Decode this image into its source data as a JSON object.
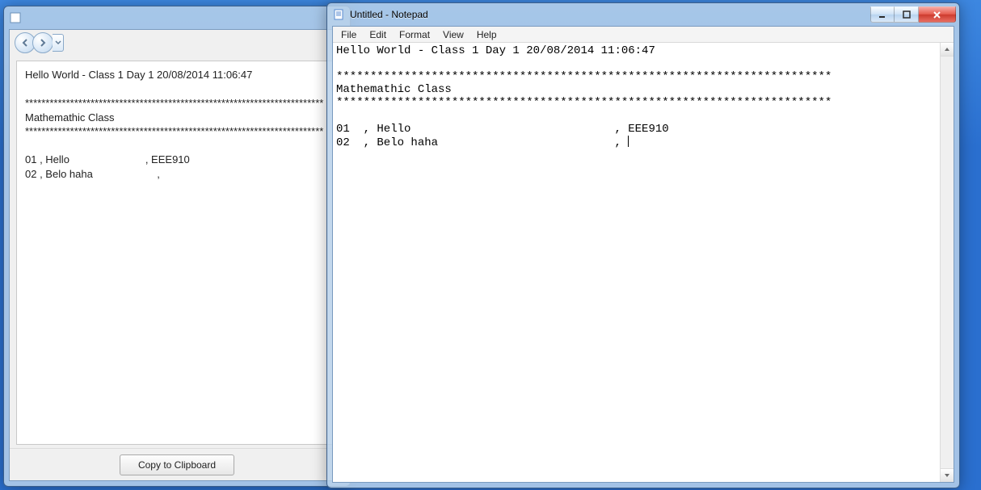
{
  "app": {
    "title": "",
    "nav": {
      "back": "back",
      "forward": "forward",
      "dropdown": "dropdown"
    },
    "content": {
      "header_line": "Hello World - Class 1 Day 1 20/08/2014 11:06:47",
      "divider1": "*************************************************************************",
      "section_title": "Mathemathic Class",
      "divider2": "*************************************************************************",
      "row1": "01 , Hello                          , EEE910",
      "row2": "02 , Belo haha                      , "
    },
    "footer": {
      "copy_label": "Copy to Clipboard"
    }
  },
  "notepad": {
    "title": "Untitled - Notepad",
    "menu": {
      "file": "File",
      "edit": "Edit",
      "format": "Format",
      "view": "View",
      "help": "Help"
    },
    "content": {
      "header_line": "Hello World - Class 1 Day 1 20/08/2014 11:06:47",
      "divider1": "*************************************************************************",
      "section_title": "Mathemathic Class",
      "divider2": "*************************************************************************",
      "row1": "01  , Hello                              , EEE910",
      "row2": "02  , Belo haha                          , "
    }
  }
}
